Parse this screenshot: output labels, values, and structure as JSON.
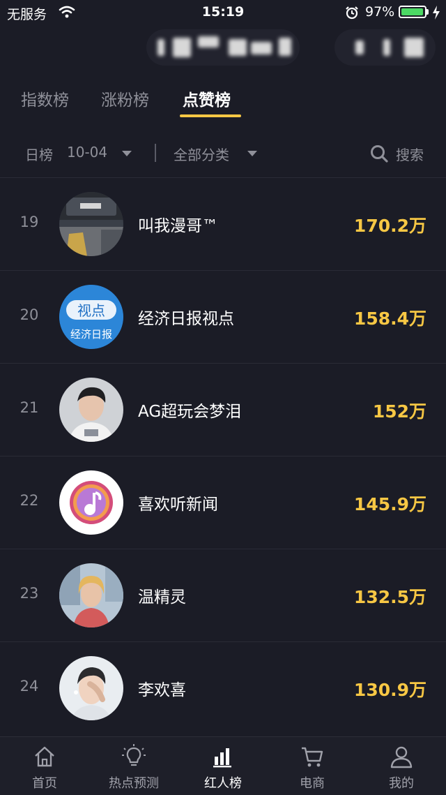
{
  "status_bar": {
    "carrier": "无服务",
    "time": "15:19",
    "battery_percent": "97%",
    "battery_level": 0.97
  },
  "tabs": [
    {
      "label": "指数榜",
      "active": false
    },
    {
      "label": "涨粉榜",
      "active": false
    },
    {
      "label": "点赞榜",
      "active": true
    }
  ],
  "filter": {
    "period": "日榜",
    "date": "10-04",
    "category": "全部分类",
    "search_label": "搜索"
  },
  "ranking": [
    {
      "rank": "19",
      "name": "叫我漫哥™",
      "likes": "170.2万",
      "avatar": "car-photo-avatar"
    },
    {
      "rank": "20",
      "name": "经济日报视点",
      "likes": "158.4万",
      "avatar": "news-logo-avatar"
    },
    {
      "rank": "21",
      "name": "AG超玩会梦泪",
      "likes": "152万",
      "avatar": "portrait-avatar"
    },
    {
      "rank": "22",
      "name": "喜欢听新闻",
      "likes": "145.9万",
      "avatar": "music-logo-avatar"
    },
    {
      "rank": "23",
      "name": "温精灵",
      "likes": "132.5万",
      "avatar": "portrait-avatar"
    },
    {
      "rank": "24",
      "name": "李欢喜",
      "likes": "130.9万",
      "avatar": "portrait-avatar"
    }
  ],
  "bottom_nav": [
    {
      "label": "首页",
      "icon": "home-icon",
      "active": false
    },
    {
      "label": "热点预测",
      "icon": "lightbulb-icon",
      "active": false
    },
    {
      "label": "红人榜",
      "icon": "bar-chart-icon",
      "active": true
    },
    {
      "label": "电商",
      "icon": "cart-icon",
      "active": false
    },
    {
      "label": "我的",
      "icon": "user-icon",
      "active": false
    }
  ],
  "colors": {
    "background": "#1b1c26",
    "accent": "#f7c744",
    "muted_text": "#8f9099",
    "battery_green": "#4cd964"
  }
}
